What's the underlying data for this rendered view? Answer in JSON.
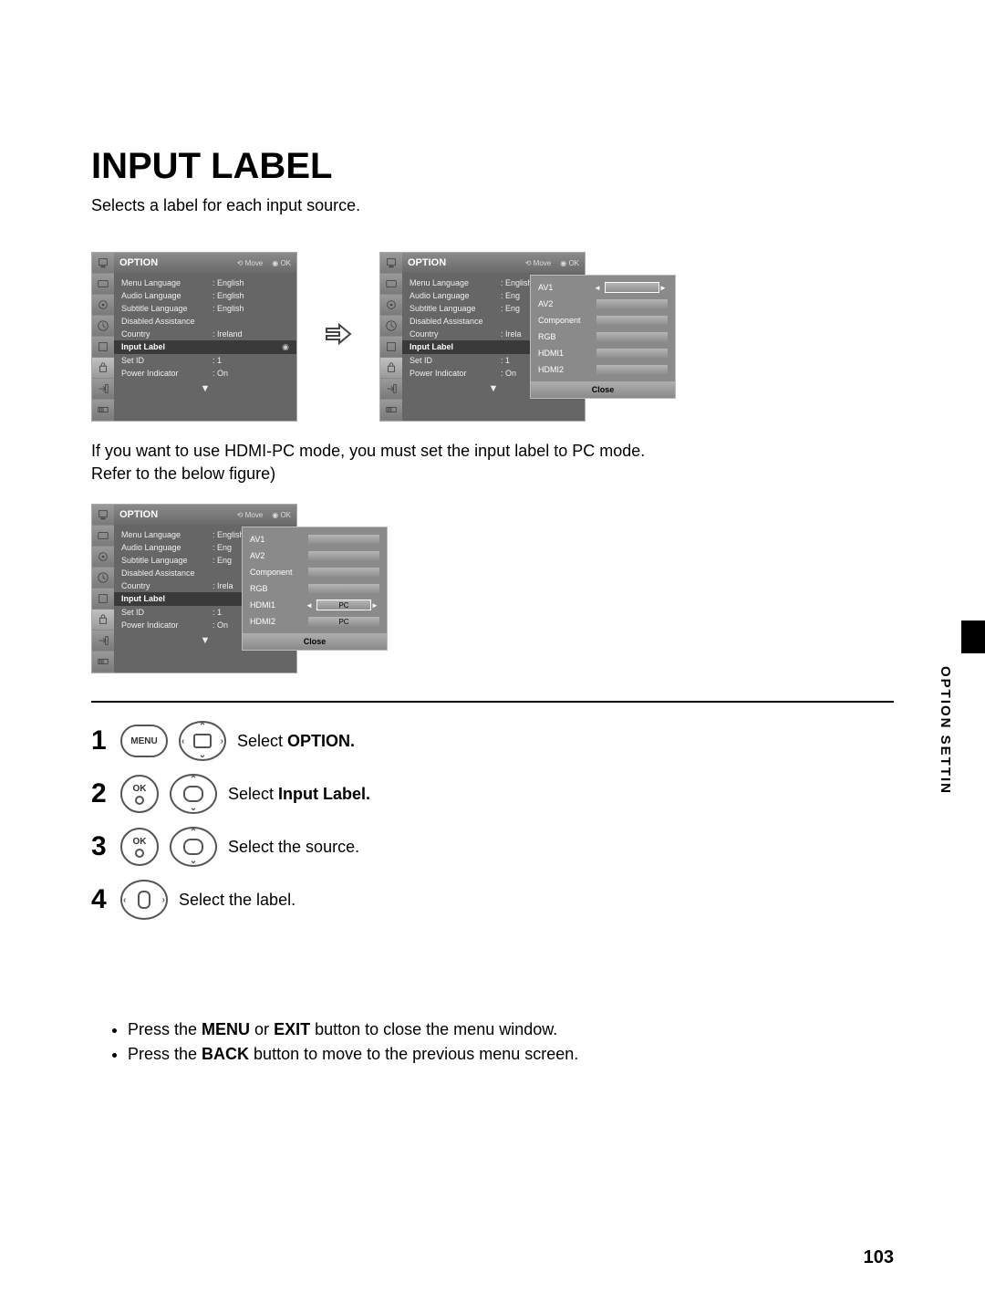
{
  "title": "INPUT LABEL",
  "lead": "Selects a label for each input source.",
  "osd": {
    "header": "OPTION",
    "hints": {
      "move": "Move",
      "ok": "OK"
    },
    "items": [
      {
        "label": "Menu Language",
        "value": "English"
      },
      {
        "label": "Audio Language",
        "value": "English"
      },
      {
        "label": "Subtitle Language",
        "value": "English"
      },
      {
        "label": "Disabled Assistance",
        "value": ""
      },
      {
        "label": "Country",
        "value": "Ireland"
      },
      {
        "label": "Input Label",
        "value": "",
        "hl": true
      },
      {
        "label": "Set ID",
        "value": "1"
      },
      {
        "label": "Power Indicator",
        "value": "On"
      }
    ],
    "truncated": {
      "audio": "Eng",
      "subtitle": "Eng",
      "country": "Irela"
    },
    "footerGlyph": "▼"
  },
  "popup": {
    "sources": [
      "AV1",
      "AV2",
      "Component",
      "RGB",
      "HDMI1",
      "HDMI2"
    ],
    "close": "Close",
    "pcLabel": "PC"
  },
  "midText1": "If you want to use HDMI-PC mode, you must set the input label to PC mode.",
  "midText2": "Refer to the below figure)",
  "steps": {
    "s1": {
      "num": "1",
      "btn1": "MENU",
      "text_a": "Select ",
      "text_b": "OPTION."
    },
    "s2": {
      "num": "2",
      "btn1": "OK",
      "text_a": "Select ",
      "text_b": "Input Label."
    },
    "s3": {
      "num": "3",
      "btn1": "OK",
      "text": "Select the source."
    },
    "s4": {
      "num": "4",
      "text": "Select the label."
    }
  },
  "bullets": {
    "b1_a": "Press the ",
    "b1_b": "MENU",
    "b1_c": " or ",
    "b1_d": "EXIT",
    "b1_e": " button to close the menu window.",
    "b2_a": "Press the ",
    "b2_b": "BACK",
    "b2_c": "  button to move to the previous menu screen."
  },
  "sideLabel": "OPTION SETTIN",
  "pageNum": "103"
}
